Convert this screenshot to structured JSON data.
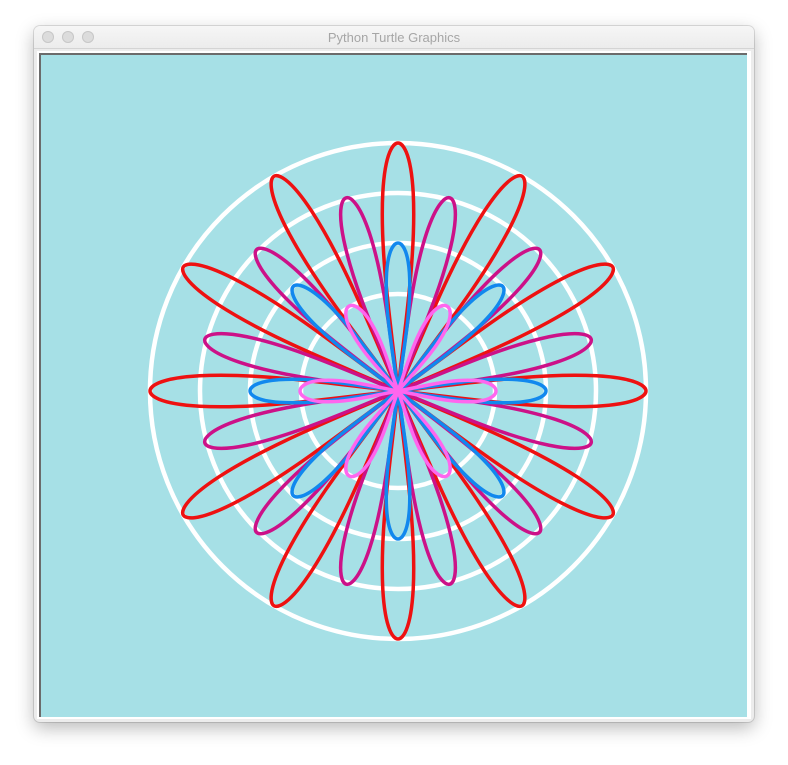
{
  "window": {
    "title": "Python Turtle Graphics"
  },
  "canvas": {
    "background_color": "#a6e0e6"
  },
  "drawing": {
    "rings_color": "#ffffff",
    "ring_count": 4,
    "flowers": [
      {
        "color": "#ee1111",
        "petals": 12
      },
      {
        "color": "#cc1188",
        "petals": 12
      },
      {
        "color": "#1188ee",
        "petals": 8
      },
      {
        "color": "#ff66ee",
        "petals": 6
      }
    ]
  }
}
